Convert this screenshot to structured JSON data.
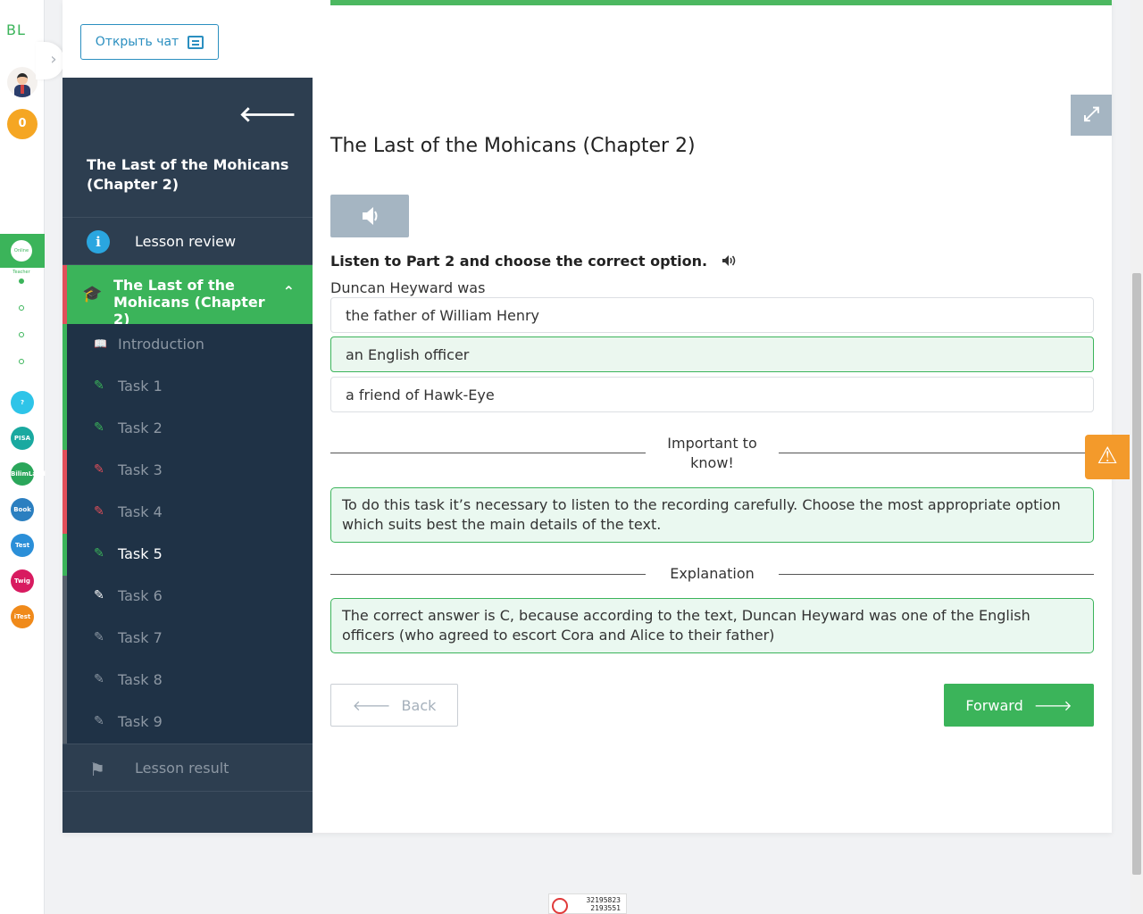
{
  "rail": {
    "logo": "BL",
    "coins": "0",
    "active_icon_label": "Online Teacher",
    "apps": [
      {
        "name": "help",
        "label": "?",
        "color": "#2ec4e8"
      },
      {
        "name": "pisa",
        "label": "PISA",
        "color": "#1aa9a0"
      },
      {
        "name": "bilimland",
        "label": "BilimLand",
        "color": "#2aa65a"
      },
      {
        "name": "bilimbook",
        "label": "Book",
        "color": "#2b7fc0"
      },
      {
        "name": "test",
        "label": "Test",
        "color": "#2b8fd8"
      },
      {
        "name": "twig",
        "label": "Twig",
        "color": "#d81b60"
      },
      {
        "name": "itest",
        "label": "iTest",
        "color": "#f08a1a"
      }
    ]
  },
  "header": {
    "chat_button": "Открыть чат"
  },
  "sidebar": {
    "title": "The Last of the Mohicans (Chapter 2)",
    "review": "Lesson review",
    "chapter": "The Last of the Mohicans (Chapter 2)",
    "items": [
      {
        "label": "Introduction",
        "status": "green",
        "icon": "book-icon",
        "active": false
      },
      {
        "label": "Task 1",
        "status": "green",
        "icon": "edit-icon",
        "active": false
      },
      {
        "label": "Task 2",
        "status": "green",
        "icon": "edit-icon",
        "active": false
      },
      {
        "label": "Task 3",
        "status": "red",
        "icon": "edit-icon",
        "active": false
      },
      {
        "label": "Task 4",
        "status": "red",
        "icon": "edit-icon",
        "active": false
      },
      {
        "label": "Task 5",
        "status": "green",
        "icon": "edit-icon",
        "active": true
      },
      {
        "label": "Task 6",
        "status": "grey",
        "icon": "edit-icon",
        "active": false
      },
      {
        "label": "Task 7",
        "status": "grey",
        "icon": "edit-icon",
        "active": false
      },
      {
        "label": "Task 8",
        "status": "grey",
        "icon": "edit-icon",
        "active": false
      },
      {
        "label": "Task 9",
        "status": "grey",
        "icon": "edit-icon",
        "active": false
      }
    ],
    "result": "Lesson result"
  },
  "content": {
    "title": "The Last of the Mohicans (Chapter 2)",
    "instruction": "Listen to Part 2 and choose the correct option.",
    "question": "Duncan Heyward was",
    "options": [
      {
        "text": "the father of William Henry",
        "selected": false
      },
      {
        "text": "an English officer",
        "selected": true
      },
      {
        "text": "a friend of Hawk-Eye",
        "selected": false
      }
    ],
    "important_label": "Important to know!",
    "important_text": "To do this task it’s necessary to listen to the recording carefully. Choose the most appropriate option which suits best the main details of the text.",
    "explanation_label": "Explanation",
    "explanation_text": "The correct answer is C, because according to the text, Duncan Heyward was one of the English officers (who agreed to escort Cora and Alice to their father)",
    "back": "Back",
    "forward": "Forward"
  },
  "counter": {
    "line1": "32195823",
    "line2": "2193551"
  },
  "colors": {
    "brand_green": "#3bb45a",
    "sidebar_bg": "#2d3e50",
    "error_red": "#e24f5a",
    "warning_orange": "#f39a2b"
  }
}
